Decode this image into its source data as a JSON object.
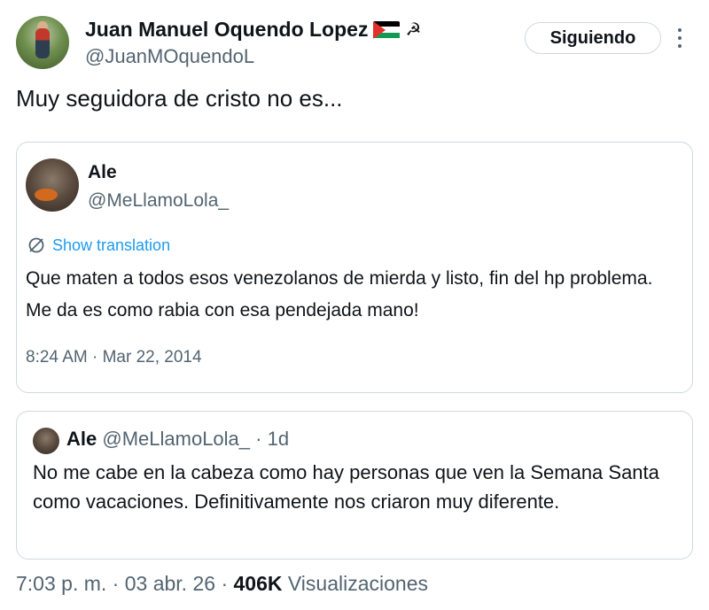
{
  "author": {
    "name": "Juan Manuel Oquendo Lopez",
    "handle": "@JuanMOquendoL",
    "hammer_glyph": "☭",
    "flag_icon": "palestine-flag-icon"
  },
  "follow_button": {
    "label": "Siguiendo"
  },
  "tweet": {
    "text": "Muy seguidora de cristo no es..."
  },
  "quoted_screenshot": {
    "name": "Ale",
    "handle": "@MeLlamoLola_",
    "show_translation": "Show translation",
    "text": "Que maten a todos esos venezolanos de mierda y listo, fin del hp problema. Me da es como rabia con esa pendejada mano!",
    "timestamp": "8:24 AM · Mar 22, 2014"
  },
  "quote_card": {
    "name": "Ale",
    "handle": "@MeLlamoLola_",
    "age": "· 1d",
    "text": "No me cabe en la cabeza como hay personas que ven la Semana Santa como vacaciones. Definitivamente nos criaron muy diferente."
  },
  "meta": {
    "time": "7:03 p. m.",
    "sep1": "·",
    "date": "03 abr. 26",
    "sep2": "·",
    "views_count": "406K",
    "views_label": "Visualizaciones"
  },
  "colors": {
    "text": "#0f1419",
    "secondary": "#536471",
    "link": "#1d9bf0",
    "border": "#cfd9de"
  }
}
